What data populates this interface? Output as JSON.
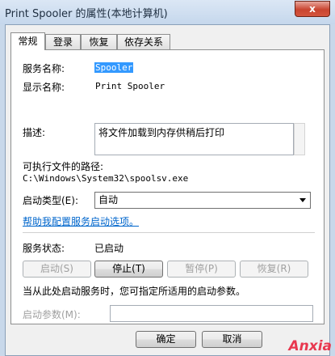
{
  "window": {
    "title": "Print Spooler 的属性(本地计算机)",
    "close": "x"
  },
  "tabs": [
    {
      "label": "常规"
    },
    {
      "label": "登录"
    },
    {
      "label": "恢复"
    },
    {
      "label": "依存关系"
    }
  ],
  "general": {
    "service_name_label": "服务名称:",
    "service_name_value": "Spooler",
    "display_name_label": "显示名称:",
    "display_name_value": "Print Spooler",
    "description_label": "描述:",
    "description_value": "将文件加载到内存供稍后打印",
    "exe_path_label": "可执行文件的路径:",
    "exe_path_value": "C:\\Windows\\System32\\spoolsv.exe",
    "startup_type_label": "启动类型(E):",
    "startup_type_value": "自动",
    "help_link": "帮助我配置服务启动选项。",
    "status_label": "服务状态:",
    "status_value": "已启动",
    "buttons": {
      "start": "启动(S)",
      "stop": "停止(T)",
      "pause": "暂停(P)",
      "resume": "恢复(R)"
    },
    "hint": "当从此处启动服务时，您可指定所适用的启动参数。",
    "param_label": "启动参数(M):",
    "param_value": ""
  },
  "footer": {
    "ok": "确定",
    "cancel": "取消"
  },
  "watermark": "Anxia"
}
